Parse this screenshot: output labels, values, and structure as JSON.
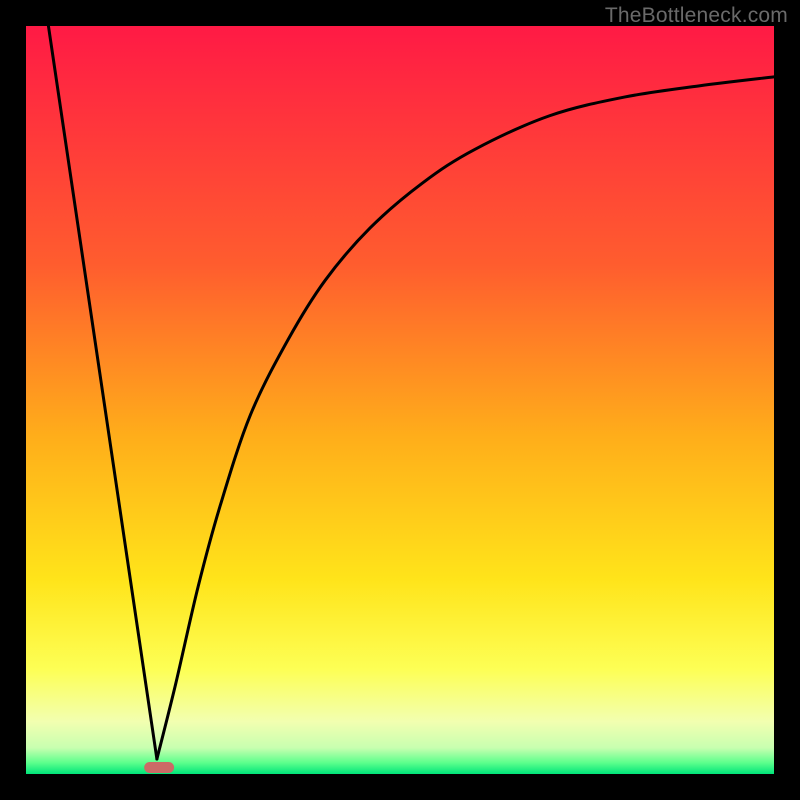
{
  "watermark": "TheBottleneck.com",
  "chart_data": {
    "type": "line",
    "title": "",
    "xlabel": "",
    "ylabel": "",
    "xlim": [
      0,
      100
    ],
    "ylim": [
      0,
      100
    ],
    "grid": false,
    "legend": false,
    "gradient_stops": [
      {
        "offset": 0,
        "color": "#ff1a45"
      },
      {
        "offset": 0.32,
        "color": "#ff5d2e"
      },
      {
        "offset": 0.55,
        "color": "#ffae1a"
      },
      {
        "offset": 0.74,
        "color": "#ffe41a"
      },
      {
        "offset": 0.86,
        "color": "#fdff55"
      },
      {
        "offset": 0.93,
        "color": "#f2ffb0"
      },
      {
        "offset": 0.965,
        "color": "#c8ffb0"
      },
      {
        "offset": 0.985,
        "color": "#5cff8c"
      },
      {
        "offset": 1.0,
        "color": "#00e47a"
      }
    ],
    "bottom_marker": {
      "x_start": 15.8,
      "x_end": 19.8,
      "color": "#cc6a66"
    },
    "series": [
      {
        "name": "left-line",
        "x": [
          3.0,
          17.5
        ],
        "y": [
          100,
          2
        ]
      },
      {
        "name": "right-curve",
        "x": [
          17.5,
          20,
          23,
          26,
          30,
          35,
          40,
          46,
          53,
          60,
          70,
          80,
          90,
          100
        ],
        "y": [
          2,
          12,
          25,
          36,
          48,
          58,
          66,
          73,
          79,
          83.5,
          88,
          90.5,
          92,
          93.2
        ]
      }
    ]
  }
}
